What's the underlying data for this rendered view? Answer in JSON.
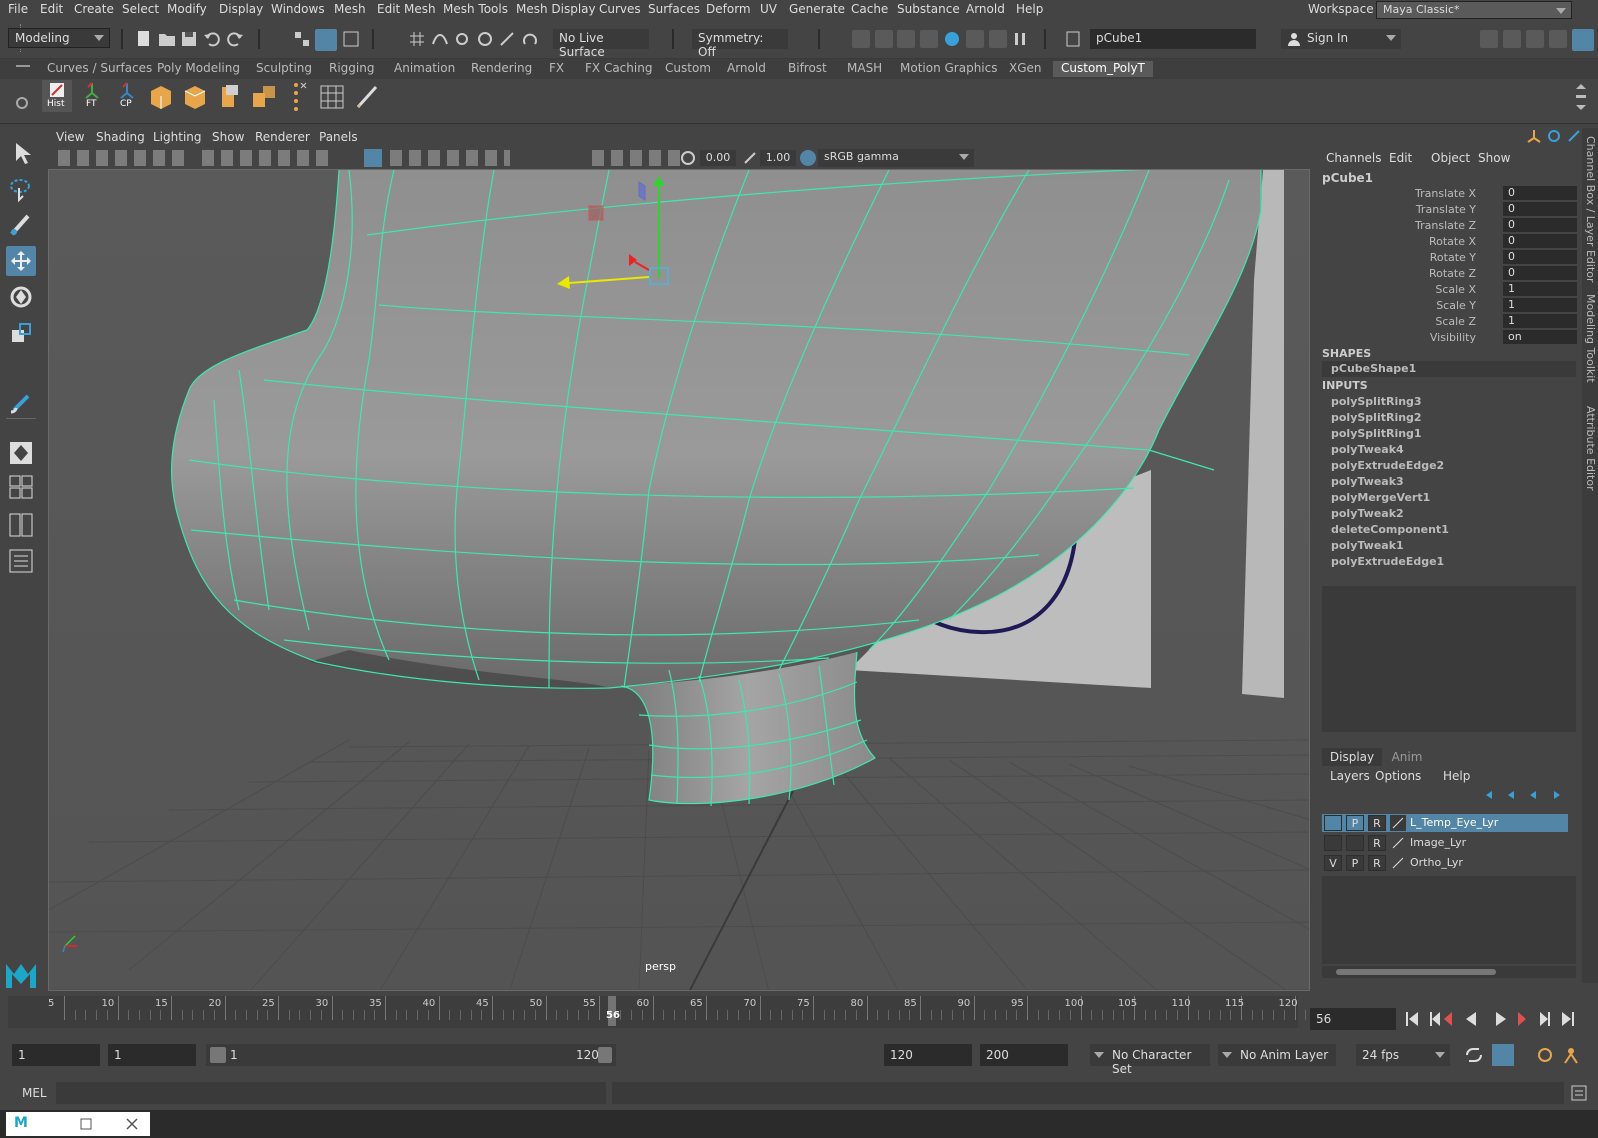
{
  "menubar": {
    "items": [
      "File",
      "Edit",
      "Create",
      "Select",
      "Modify",
      "Display",
      "Windows",
      "Mesh",
      "Edit Mesh",
      "Mesh Tools",
      "Mesh Display",
      "Curves",
      "Surfaces",
      "Deform",
      "UV",
      "Generate",
      "Cache",
      "Substance",
      "Arnold",
      "Help"
    ],
    "workspace_label": "Workspace :",
    "workspace_value": "Maya Classic*"
  },
  "statusline": {
    "mode": "Modeling",
    "live_surface": "No Live Surface",
    "symmetry": "Symmetry: Off",
    "object_field": "pCube1",
    "sign_in": "Sign In"
  },
  "shelf": {
    "tabs": [
      "Curves / Surfaces",
      "Poly Modeling",
      "Sculpting",
      "Rigging",
      "Animation",
      "Rendering",
      "FX",
      "FX Caching",
      "Custom",
      "Arnold",
      "Bifrost",
      "MASH",
      "Motion Graphics",
      "XGen",
      "Custom_PolyT"
    ],
    "active_tab": "Custom_PolyT",
    "buttons": [
      "Hist",
      "FT",
      "CP"
    ]
  },
  "viewport": {
    "menu": [
      "View",
      "Shading",
      "Lighting",
      "Show",
      "Renderer",
      "Panels"
    ],
    "exposure": "0.00",
    "gamma": "1.00",
    "colorspace": "sRGB gamma",
    "camera_label": "persp"
  },
  "channelbox": {
    "menu": [
      "Channels",
      "Edit",
      "Object",
      "Show"
    ],
    "object": "pCube1",
    "attributes": [
      {
        "label": "Translate X",
        "value": "0"
      },
      {
        "label": "Translate Y",
        "value": "0"
      },
      {
        "label": "Translate Z",
        "value": "0"
      },
      {
        "label": "Rotate X",
        "value": "0"
      },
      {
        "label": "Rotate Y",
        "value": "0"
      },
      {
        "label": "Rotate Z",
        "value": "0"
      },
      {
        "label": "Scale X",
        "value": "1"
      },
      {
        "label": "Scale Y",
        "value": "1"
      },
      {
        "label": "Scale Z",
        "value": "1"
      },
      {
        "label": "Visibility",
        "value": "on"
      }
    ],
    "shapes_header": "SHAPES",
    "shape": "pCubeShape1",
    "inputs_header": "INPUTS",
    "inputs": [
      "polySplitRing3",
      "polySplitRing2",
      "polySplitRing1",
      "polyTweak4",
      "polyExtrudeEdge2",
      "polyTweak3",
      "polyMergeVert1",
      "polyTweak2",
      "deleteComponent1",
      "polyTweak1",
      "polyExtrudeEdge1"
    ]
  },
  "layers": {
    "tabs": [
      "Display",
      "Anim"
    ],
    "menu": [
      "Layers",
      "Options",
      "Help"
    ],
    "rows": [
      {
        "v": "",
        "p": "P",
        "r": "R",
        "name": "L_Temp_Eye_Lyr",
        "selected": true
      },
      {
        "v": "",
        "p": "",
        "r": "R",
        "name": "Image_Lyr",
        "selected": false
      },
      {
        "v": "V",
        "p": "P",
        "r": "R",
        "name": "Ortho_Lyr",
        "selected": false
      }
    ]
  },
  "side_tabs": [
    "Channel Box / Layer Editor",
    "Modeling Toolkit",
    "Attribute Editor"
  ],
  "timeline": {
    "ticks": [
      "5",
      "10",
      "15",
      "20",
      "25",
      "30",
      "35",
      "40",
      "45",
      "50",
      "55",
      "60",
      "65",
      "70",
      "75",
      "80",
      "85",
      "90",
      "95",
      "100",
      "105",
      "110",
      "115",
      "120"
    ],
    "current_frame_marker": "56",
    "current_frame_field": "56"
  },
  "range": {
    "start": "1",
    "start2": "1",
    "slider_start": "1",
    "slider_end": "120",
    "end": "120",
    "end2": "200",
    "character_set": "No Character Set",
    "anim_layer": "No Anim Layer",
    "fps": "24 fps"
  },
  "cmdline": {
    "label": "MEL"
  },
  "colors": {
    "wire": "#3fe6b0",
    "accent": "#5285a6",
    "bg": "#444444"
  }
}
